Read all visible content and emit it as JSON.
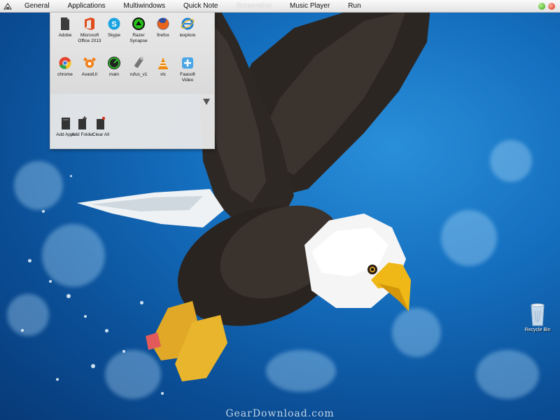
{
  "menu": {
    "items": [
      "General",
      "Applications",
      "Multiwindows",
      "Quick Note",
      "Screenshot",
      "Music Player",
      "Run"
    ],
    "active_index": 4
  },
  "panel": {
    "apps": [
      {
        "label": "Adobe",
        "icon": "adobe-file-icon",
        "color": "#444444"
      },
      {
        "label": "Microsoft Office 2013",
        "icon": "office-icon",
        "color": "#e14c1c"
      },
      {
        "label": "Skype",
        "icon": "skype-icon",
        "color": "#1aa3e0"
      },
      {
        "label": "Razer Synapse",
        "icon": "razer-icon",
        "color": "#29c21a"
      },
      {
        "label": "firefox",
        "icon": "firefox-icon",
        "color": "#e8641b"
      },
      {
        "label": "iexplore",
        "icon": "ie-icon",
        "color": "#1b7fd4"
      },
      {
        "label": "chrome",
        "icon": "chrome-icon",
        "color": "#e4432d"
      },
      {
        "label": "AvastUI",
        "icon": "avast-icon",
        "color": "#f0821e"
      },
      {
        "label": "main",
        "icon": "main-app-icon",
        "color": "#2fb52a"
      },
      {
        "label": "rufus_v1",
        "icon": "usb-drive-icon",
        "color": "#777777"
      },
      {
        "label": "vlc",
        "icon": "vlc-icon",
        "color": "#f08a0c"
      },
      {
        "label": "Faasoft Video",
        "icon": "faasoft-icon",
        "color": "#4aa6e6"
      }
    ],
    "actions": [
      {
        "label": "Add Apps",
        "icon": "add-apps-icon"
      },
      {
        "label": "Add Folder",
        "icon": "add-folder-icon"
      },
      {
        "label": "Clear All",
        "icon": "clear-all-icon"
      }
    ]
  },
  "desktop": {
    "recycle_bin_label": "Recycle Bin",
    "watermark": "GearDownload.com"
  }
}
